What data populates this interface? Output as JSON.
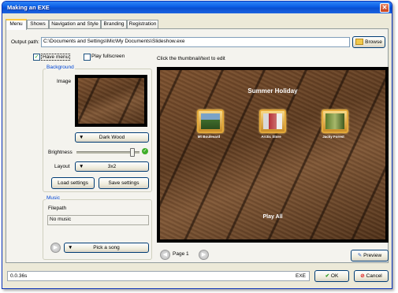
{
  "window": {
    "title": "Making an EXE",
    "close_glyph": "✕"
  },
  "tabs": [
    {
      "label": "Menu"
    },
    {
      "label": "Shows"
    },
    {
      "label": "Navigation and Style"
    },
    {
      "label": "Branding"
    },
    {
      "label": "Registration"
    }
  ],
  "output": {
    "label": "Output path:",
    "value": "C:\\Documents and Settings\\Mic\\My Documents\\Slideshow.exe",
    "browse_label": "Browse"
  },
  "options": {
    "have_menu_label": "Have menu",
    "have_menu_checked": true,
    "play_fullscreen_label": "Play fullscreen",
    "play_fullscreen_checked": false,
    "hint": "Click the thumbnail/text to edit"
  },
  "background": {
    "group_title": "Background",
    "image_label": "Image",
    "style_value": "Dark Wood",
    "brightness_label": "Brightness",
    "brightness_level": 0.85,
    "layout_label": "Layout",
    "layout_value": "3x2",
    "load_label": "Load settings",
    "save_label": "Save settings"
  },
  "music": {
    "group_title": "Music",
    "filepath_label": "Filepath",
    "filepath_value": "No music",
    "pick_label": "Pick a song"
  },
  "preview": {
    "title": "Summer Holiday",
    "items": [
      {
        "caption": "Mt Boulevard"
      },
      {
        "caption": "Arctic Store"
      },
      {
        "caption": "Jacky Forest"
      }
    ],
    "play_all": "Play All",
    "page_label": "Page 1",
    "preview_button": "Preview"
  },
  "statusbar": {
    "time": "0.0.36s",
    "type": "EXE",
    "ok_label": "OK",
    "cancel_label": "Cancel"
  }
}
